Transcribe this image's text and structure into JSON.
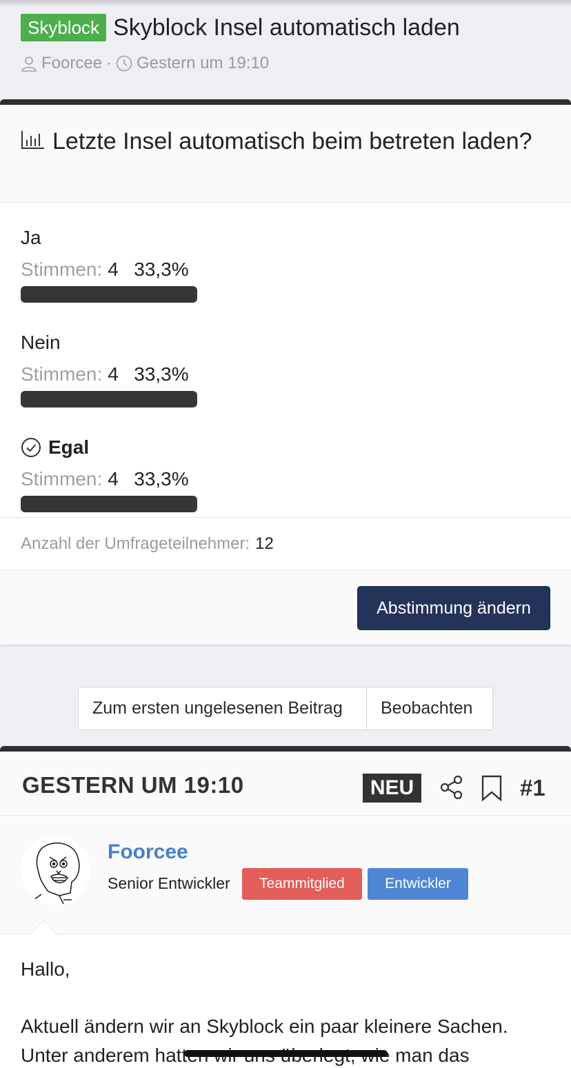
{
  "thread": {
    "prefix": "Skyblock",
    "title": "Skyblock Insel automatisch laden",
    "author": "Foorcee",
    "separator": "·",
    "date": "Gestern um 19:10"
  },
  "poll": {
    "question": "Letzte Insel automatisch beim betreten laden?",
    "votes_label": "Stimmen:",
    "options": [
      {
        "label": "Ja",
        "votes": "4",
        "percent": "33,3%",
        "fraction": 0.333,
        "selected": false
      },
      {
        "label": "Nein",
        "votes": "4",
        "percent": "33,3%",
        "fraction": 0.333,
        "selected": false
      },
      {
        "label": "Egal",
        "votes": "4",
        "percent": "33,3%",
        "fraction": 0.333,
        "selected": true
      }
    ],
    "participants_label": "Anzahl der Umfrageteilnehmer:",
    "participants": "12",
    "change_vote_button": "Abstimmung ändern"
  },
  "actions": {
    "first_unread": "Zum ersten ungelesenen Beitrag",
    "watch": "Beobachten"
  },
  "post": {
    "date": "GESTERN UM 19:10",
    "new_badge": "NEU",
    "number": "#1",
    "author": "Foorcee",
    "user_title": "Senior Entwickler",
    "badges": [
      "Teammitglied",
      "Entwickler"
    ],
    "greeting": "Hallo,",
    "body": "Aktuell ändern wir an Skyblock ein paar kleinere Sachen. Unter anderem hatten wir uns überlegt, wie man das"
  },
  "colors": {
    "prefix_green": "#4cae4c",
    "button_navy": "#25325a",
    "badge_red": "#e35d5a",
    "badge_blue": "#4e86d4",
    "author_link": "#4a7fcb",
    "bar_fill": "#363636"
  }
}
